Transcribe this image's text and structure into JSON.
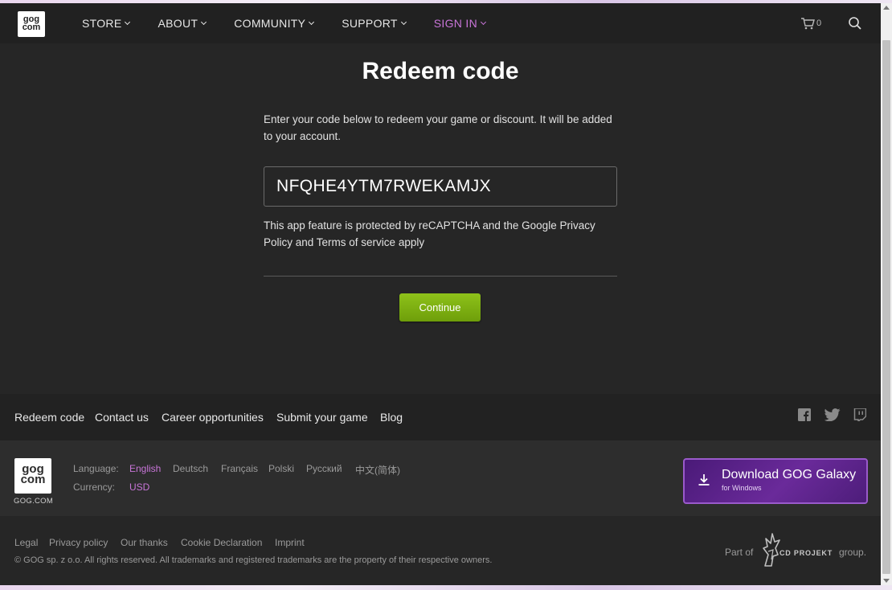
{
  "header": {
    "logo": {
      "line1": "gog",
      "line2": "com"
    },
    "nav": [
      {
        "label": "STORE"
      },
      {
        "label": "ABOUT"
      },
      {
        "label": "COMMUNITY"
      },
      {
        "label": "SUPPORT"
      },
      {
        "label": "SIGN IN"
      }
    ],
    "cart_count": "0",
    "accent_color": "#c875d8"
  },
  "main": {
    "title": "Redeem code",
    "intro": "Enter your code below to redeem your game or discount. It will be added to your account.",
    "code_value": "NFQHE4YTM7RWEKAMJX",
    "captcha_note": "This app feature is protected by reCAPTCHA and the Google Privacy Policy and Terms of service apply",
    "continue_label": "Continue",
    "button_color": "#7fb012"
  },
  "footer_links": [
    {
      "label": "Redeem code"
    },
    {
      "label": "Contact us"
    },
    {
      "label": "Career opportunities"
    },
    {
      "label": "Submit your game"
    },
    {
      "label": "Blog"
    }
  ],
  "social_icons": [
    "facebook-icon",
    "twitter-icon",
    "twitch-icon"
  ],
  "footer": {
    "logo_label": "GOG.COM",
    "language_label": "Language:",
    "languages": [
      "English",
      "Deutsch",
      "Français",
      "Polski",
      "Русский",
      "中文(简体)"
    ],
    "selected_language": "English",
    "currency_label": "Currency:",
    "currency_value": "USD",
    "galaxy_main": "Download GOG Galaxy",
    "galaxy_sub": "for Windows",
    "legal_links": [
      "Legal",
      "Privacy policy",
      "Our thanks",
      "Cookie Declaration",
      "Imprint"
    ],
    "copyright": "© GOG sp. z o.o. All rights reserved. All trademarks and registered trademarks are the property of their respective owners.",
    "part_of": "Part of",
    "cdp_name": "CD PROJEKT",
    "group": "group."
  }
}
